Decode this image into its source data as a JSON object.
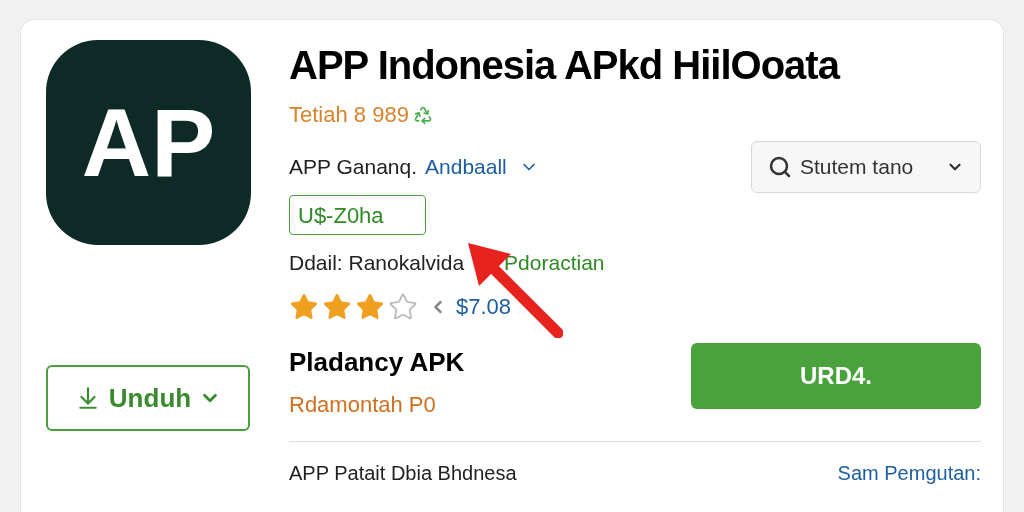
{
  "app": {
    "logo_text": "AP",
    "title": "APP Indonesia APkd HiilOoata",
    "subtitle": "Tetiah 8 989",
    "meta_prefix": "APP Gananq.",
    "meta_link": "Andbaall",
    "price_badge": "U$-Z0ha",
    "detail_label": "Ddail: Ranokalvida",
    "detail_value": "Pdoractian",
    "stars": 3,
    "rating_price": "$7.08"
  },
  "search_button": {
    "label": "Stutem tano"
  },
  "download_button": {
    "label": "Unduh"
  },
  "package": {
    "name": "Pladancy APK",
    "note": "Rdamontah P0"
  },
  "primary_button": {
    "label": "URD4."
  },
  "footer": {
    "text": "APP Patait Dbia Bhdnesa",
    "link": "Sam Pemgutan:"
  }
}
